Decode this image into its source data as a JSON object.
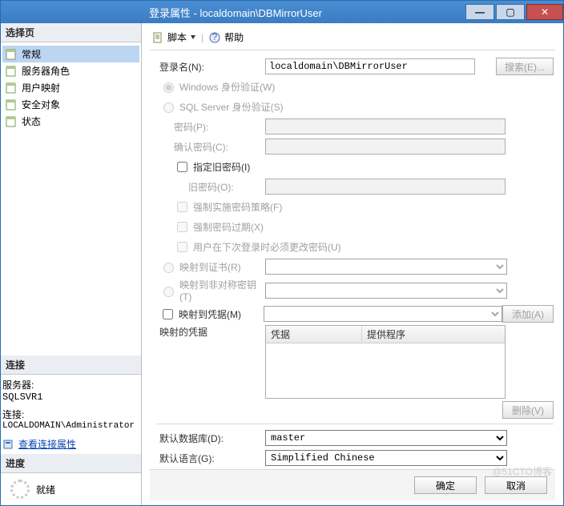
{
  "title": "登录属性 - localdomain\\DBMirrorUser",
  "left": {
    "select_page_hd": "选择页",
    "nav": [
      {
        "label": "常规",
        "sel": true
      },
      {
        "label": "服务器角色"
      },
      {
        "label": "用户映射"
      },
      {
        "label": "安全对象"
      },
      {
        "label": "状态"
      }
    ],
    "conn_hd": "连接",
    "server_lbl": "服务器:",
    "server_val": "SQLSVR1",
    "conn_lbl": "连接:",
    "conn_val": "LOCALDOMAIN\\Administrator",
    "view_conn": "查看连接属性",
    "progress_hd": "进度",
    "ready": "就绪"
  },
  "toolbar": {
    "script": "脚本",
    "help": "帮助"
  },
  "form": {
    "login_name": "登录名(N):",
    "login_value": "localdomain\\DBMirrorUser",
    "search": "搜索(E)...",
    "win_auth": "Windows 身份验证(W)",
    "sql_auth": "SQL Server 身份验证(S)",
    "pwd": "密码(P):",
    "pwd2": "确认密码(C):",
    "spec_old": "指定旧密码(I)",
    "old_pwd": "旧密码(O):",
    "enforce_pol": "强制实施密码策略(F)",
    "enforce_exp": "强制密码过期(X)",
    "must_change": "用户在下次登录时必须更改密码(U)",
    "map_cert": "映射到证书(R)",
    "map_asym": "映射到非对称密钥(T)",
    "map_cred": "映射到凭据(M)",
    "add": "添加(A)",
    "mapped_cred": "映射的凭据",
    "col_cred": "凭据",
    "col_prov": "提供程序",
    "remove": "删除(V)",
    "def_db": "默认数据库(D):",
    "def_db_val": "master",
    "def_lang": "默认语言(G):",
    "def_lang_val": "Simplified Chinese"
  },
  "footer": {
    "ok": "确定",
    "cancel": "取消"
  },
  "watermark": "@51CTO博客"
}
